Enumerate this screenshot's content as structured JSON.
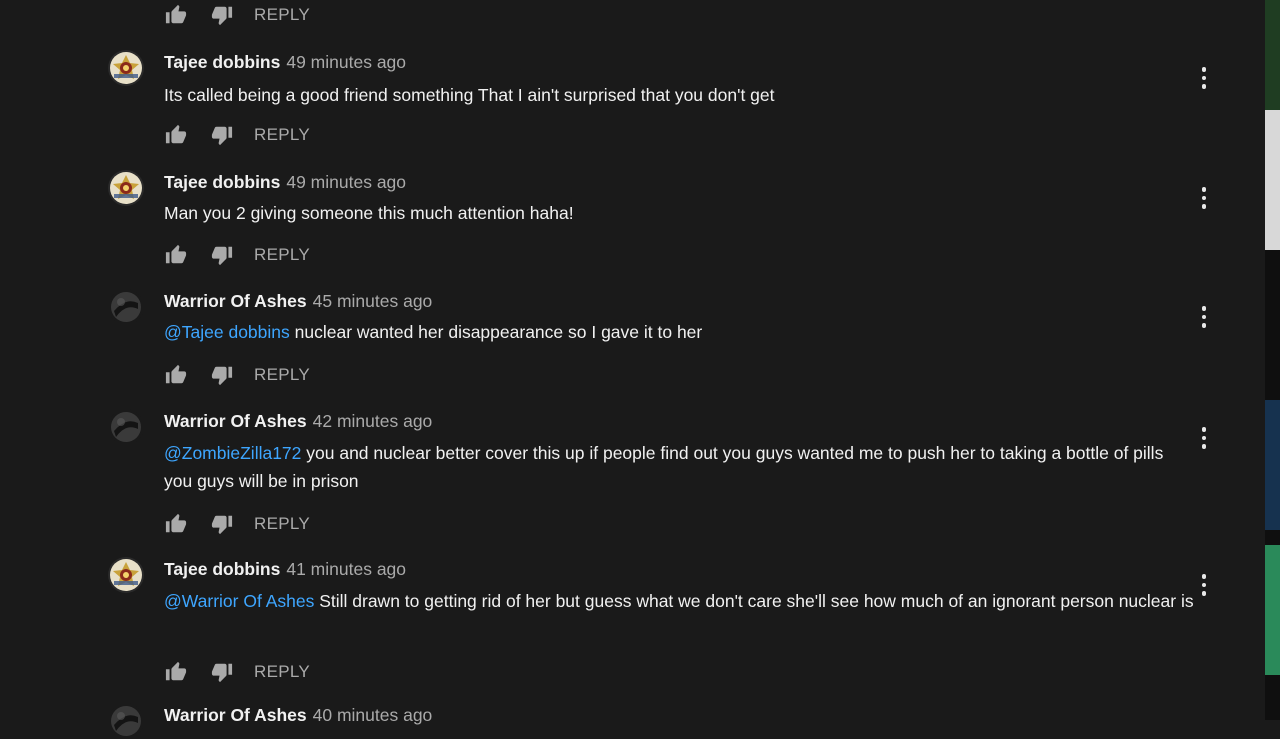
{
  "reply_label": "REPLY",
  "top_partial_row": {
    "reply_label": "REPLY"
  },
  "comments": [
    {
      "author": "Tajee dobbins",
      "time": "49 minutes ago",
      "avatar_icon": "badge-avatar-icon",
      "mention": "",
      "text": "Its called being a good friend something That I ain't surprised that you don't get"
    },
    {
      "author": "Tajee dobbins",
      "time": "49 minutes ago",
      "avatar_icon": "badge-avatar-icon",
      "mention": "",
      "text": "Man you 2 giving someone this much attention haha!"
    },
    {
      "author": "Warrior Of Ashes",
      "time": "45 minutes ago",
      "avatar_icon": "dark-sphere-avatar-icon",
      "mention": "@Tajee dobbins",
      "text": " nuclear wanted her disappearance so I gave it to her"
    },
    {
      "author": "Warrior Of Ashes",
      "time": "42 minutes ago",
      "avatar_icon": "dark-sphere-avatar-icon",
      "mention": "@ZombieZilla172",
      "text": " you and nuclear better cover this up if people find out you guys wanted me to push her to taking a bottle of pills you guys will be in prison"
    },
    {
      "author": "Tajee dobbins",
      "time": "41 minutes ago",
      "avatar_icon": "badge-avatar-icon",
      "mention": "@Warrior Of Ashes",
      "text": " Still drawn to getting rid of her but guess what we don't care she'll see how much of an ignorant person nuclear is"
    },
    {
      "author": "Warrior Of Ashes",
      "time": "40 minutes ago",
      "avatar_icon": "dark-sphere-avatar-icon",
      "mention": "",
      "text": ""
    }
  ],
  "colors": {
    "background": "#1a1a1a",
    "text": "#f1f1f1",
    "secondary_text": "#aaaaaa",
    "mention_link": "#3ea6ff"
  },
  "icons": [
    "thumb-up-icon",
    "thumb-down-icon",
    "more-vert-icon"
  ]
}
